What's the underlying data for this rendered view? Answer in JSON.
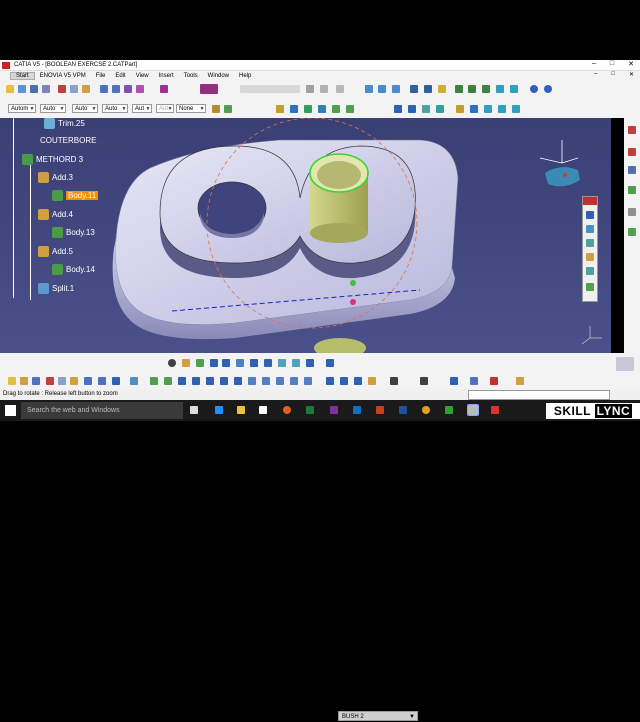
{
  "window": {
    "title": "CATIA V5 - [BOOLEAN EXERCSE 2.CATPart]",
    "controls": [
      "–",
      "□",
      "✕"
    ]
  },
  "menubar": {
    "items": [
      "Start",
      "ENOVIA V5 VPM",
      "File",
      "Edit",
      "View",
      "Insert",
      "Tools",
      "Window",
      "Help"
    ],
    "doc_controls": [
      "–",
      "□",
      "✕"
    ]
  },
  "toolbar2": {
    "combos": [
      "Autom",
      "Auto",
      "Auto",
      "Auto",
      "Aut",
      "Aut",
      "None"
    ]
  },
  "tree": {
    "nodes": [
      {
        "label": "Trim.25"
      },
      {
        "label": "COUTERBORE"
      },
      {
        "label": "METHORD 3"
      },
      {
        "label": "Add.3"
      },
      {
        "label": "Body.11"
      },
      {
        "label": "Add.4"
      },
      {
        "label": "Body.13"
      },
      {
        "label": "Add.5"
      },
      {
        "label": "Body.14"
      },
      {
        "label": "Split.1"
      }
    ]
  },
  "bottom_toolbar": {
    "body_select": "BUSH 2"
  },
  "status": {
    "message": "Drag to rotate : Release left button to zoom"
  },
  "taskbar": {
    "search_placeholder": "Search the web and Windows"
  },
  "brand": {
    "part1": "SKILL",
    "part2": "LYNC"
  },
  "colors": {
    "viewport_bg": "#3f447c",
    "selected_node": "#ff8c00",
    "part_face": "#c8c8e8",
    "bush_green": "#b6bd6a"
  }
}
